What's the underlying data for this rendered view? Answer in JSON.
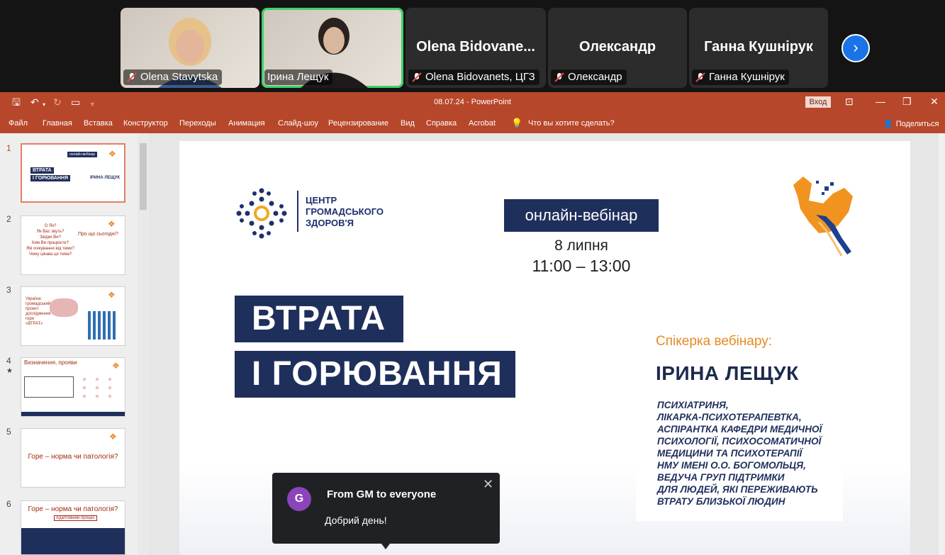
{
  "participants": [
    {
      "name_label": "Olena Stavytska",
      "mic_off": true,
      "has_video": true
    },
    {
      "name_label": "Ірина Лещук",
      "mic_off": false,
      "has_video": true,
      "active_speaker": true
    },
    {
      "display_name": "Olena  Bidovane...",
      "name_label": "Olena Bidovanets, ЦГЗ",
      "mic_off": true,
      "has_video": false
    },
    {
      "display_name": "Олександр",
      "name_label": "Олександр",
      "mic_off": true,
      "has_video": false
    },
    {
      "display_name": "Ганна Кушнірук",
      "name_label": "Ганна Кушнірук",
      "mic_off": true,
      "has_video": false
    }
  ],
  "next_participants_icon": "chevron-right-icon",
  "powerpoint": {
    "doc_title": "08.07.24  -  PowerPoint",
    "sign_in": "Вход",
    "menu": [
      "Файл",
      "Главная",
      "Вставка",
      "Конструктор",
      "Переходы",
      "Анимация",
      "Слайд-шоу",
      "Рецензирование",
      "Вид",
      "Справка",
      "Acrobat"
    ],
    "tell_me": "Что вы хотите сделать?",
    "share": "Поделиться",
    "accent_color": "#b7472a"
  },
  "thumbnails": {
    "numbers": [
      "1",
      "2",
      "3",
      "4",
      "5",
      "6"
    ],
    "t1": {
      "title_1": "ВТРАТА",
      "title_2": "І ГОРЮВАННЯ",
      "badge": "онлайн-вебінар",
      "name": "ІРИНА ЛЕЩУК"
    },
    "t2": {
      "left": "О Як?\nЯк Вас звуть?\nЗвідки Ви?\nКим Ви працюєте?\nЯкі очікування від теми?\nЧому цікава ця тема?",
      "right_title": "Про що сьогодні?"
    },
    "t3": {
      "text": "Україна: громадський проект дослідження горя «ВТРАТ»"
    },
    "t4": {
      "title": "Визначення, прояви"
    },
    "t5": {
      "text": "Горе – норма чи патологія?"
    },
    "t6": {
      "title": "Горе – норма чи патологія?",
      "sub": "Адаптивний процес"
    }
  },
  "slide": {
    "org_name_1": "ЦЕНТР",
    "org_name_2": "ГРОМАДСЬКОГО",
    "org_name_3": "ЗДОРОВ'Я",
    "webinar_label": "онлайн-вебінар",
    "date": "8 липня",
    "time": "11:00 – 13:00",
    "title_1": "ВТРАТА",
    "title_2": "І ГОРЮВАННЯ",
    "speaker_label": "Спікерка вебінару:",
    "speaker_name": "ІРИНА ЛЕЩУК",
    "speaker_bio": [
      "ПСИХІАТРИНЯ,",
      "ЛІКАРКА-ПСИХОТЕРАПЕВТКА,",
      "АСПІРАНТКА КАФЕДРИ МЕДИЧНОЇ",
      "ПСИХОЛОГІЇ, ПСИХОСОМАТИЧНОЇ",
      "МЕДИЦИНИ ТА ПСИХОТЕРАПІЇ",
      "НМУ ІМЕНІ О.О. БОГОМОЛЬЦЯ,",
      "ВЕДУЧА ГРУП ПІДТРИМКИ",
      "ДЛЯ ЛЮДЕЙ, ЯКІ ПЕРЕЖИВАЮТЬ",
      "ВТРАТУ БЛИЗЬКОЇ ЛЮДИН"
    ],
    "navy_color": "#1f2f5c",
    "orange_color": "#e78a24"
  },
  "chat_toast": {
    "avatar_letter": "G",
    "title": "From GM to everyone",
    "message": "Добрий день!",
    "avatar_color": "#8c44b9"
  }
}
